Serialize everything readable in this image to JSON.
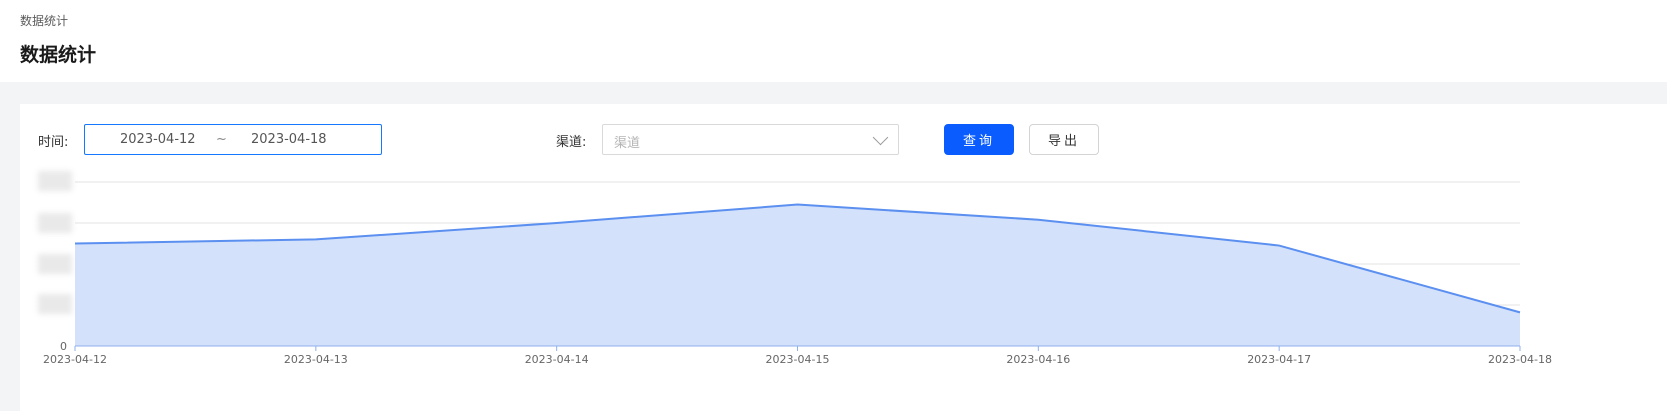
{
  "header": {
    "breadcrumb": "数据统计",
    "title": "数据统计"
  },
  "filters": {
    "time_label": "时间:",
    "date_start": "2023-04-12",
    "date_separator": "~",
    "date_end": "2023-04-18",
    "channel_label": "渠道:",
    "channel_placeholder": "渠道",
    "query_button": "查询",
    "export_button": "导出"
  },
  "colors": {
    "primary": "#0a5cff",
    "line": "#5b8ff0",
    "area": "#d3e1fb"
  },
  "chart_data": {
    "type": "area",
    "x": [
      "2023-04-12",
      "2023-04-13",
      "2023-04-14",
      "2023-04-15",
      "2023-04-16",
      "2023-04-17",
      "2023-04-18"
    ],
    "series": [
      {
        "values": [
          2.5,
          2.6,
          3.0,
          3.45,
          3.08,
          2.45,
          0.82
        ]
      }
    ],
    "ylim": [
      0,
      4
    ],
    "y_tick_labels": [
      "0"
    ],
    "grid": true,
    "xlabel": "",
    "ylabel": ""
  }
}
